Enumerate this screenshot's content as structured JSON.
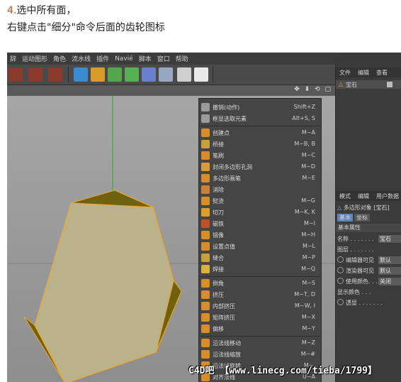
{
  "caption": {
    "step_number": "4.",
    "line1": "选中所有面，",
    "line2": "右键点击\"细分\"命令后面的齿轮图标"
  },
  "menubar": [
    "辞",
    "运动图形",
    "角色",
    "流水线",
    "插件",
    "Navié",
    "脚本",
    "窗口",
    "帮助"
  ],
  "toolbar_icons": [
    "render-region-icon",
    "render-view-icon",
    "render-settings-icon",
    "cube-icon",
    "pen-icon",
    "subdivision-icon",
    "cloner-icon",
    "deformer-icon",
    "floor-icon",
    "camera-icon",
    "light-icon"
  ],
  "viewport": {
    "nav_icons": "✥ ⬇ ⟲ ▢",
    "object_fill": "#b9b28b",
    "selected_face_color": "#6e6110",
    "edge_color": "#f2a52a"
  },
  "context_menu": {
    "items": [
      {
        "label": "撤销(动作)",
        "shortcut": "Shift+Z",
        "icon": "undo-icon"
      },
      {
        "label": "框显选取元素",
        "shortcut": "Alt+S, S",
        "icon": "frame-selection-icon"
      },
      {
        "label": "创建点",
        "shortcut": "M~A",
        "icon": "create-point-icon"
      },
      {
        "label": "桥接",
        "shortcut": "M~B, B",
        "icon": "bridge-icon"
      },
      {
        "label": "笔刷",
        "shortcut": "M~C",
        "icon": "brush-icon"
      },
      {
        "label": "封闭多边形孔洞",
        "shortcut": "M~D",
        "icon": "close-hole-icon"
      },
      {
        "label": "多边形画笔",
        "shortcut": "M~E",
        "icon": "polygon-pen-icon"
      },
      {
        "label": "消除",
        "shortcut": "",
        "icon": "dissolve-icon"
      },
      {
        "label": "熨烫",
        "shortcut": "M~G",
        "icon": "iron-icon"
      },
      {
        "label": "切刀",
        "shortcut": "M~K, K",
        "icon": "knife-icon"
      },
      {
        "label": "磁铁",
        "shortcut": "M~I",
        "icon": "magnet-icon"
      },
      {
        "label": "镜像",
        "shortcut": "M~H",
        "icon": "mirror-icon"
      },
      {
        "label": "设置点值",
        "shortcut": "M~L",
        "icon": "set-point-value-icon"
      },
      {
        "label": "缝合",
        "shortcut": "M~P",
        "icon": "stitch-icon"
      },
      {
        "label": "焊接",
        "shortcut": "M~Q",
        "icon": "weld-icon"
      },
      {
        "label": "倒角",
        "shortcut": "M~S",
        "icon": "bevel-icon"
      },
      {
        "label": "挤压",
        "shortcut": "M~T, D",
        "icon": "extrude-icon"
      },
      {
        "label": "内部挤压",
        "shortcut": "M~W, I",
        "icon": "extrude-inner-icon"
      },
      {
        "label": "矩阵挤压",
        "shortcut": "M~X",
        "icon": "matrix-extrude-icon"
      },
      {
        "label": "偏移",
        "shortcut": "M~Y",
        "icon": "offset-icon"
      },
      {
        "label": "沿法线移动",
        "shortcut": "M~Z",
        "icon": "normal-move-icon"
      },
      {
        "label": "沿法线缩放",
        "shortcut": "M~#",
        "icon": "normal-scale-icon"
      },
      {
        "label": "沿法线旋转",
        "shortcut": "M~,",
        "icon": "normal-rotate-icon"
      },
      {
        "label": "对齐法线",
        "shortcut": "U~A",
        "icon": "align-normals-icon"
      }
    ]
  },
  "object_manager": {
    "tabs": [
      "文件",
      "编辑",
      "查看"
    ],
    "object_name": "宝石"
  },
  "attribute_manager": {
    "tabs": [
      "模式",
      "编辑",
      "用户数据"
    ],
    "title": "多边形对象 [宝石]",
    "subtabs": [
      "基本",
      "坐标"
    ],
    "section": "基本属性",
    "fields": [
      {
        "label": "名称 . . . . . . .",
        "value": "宝石",
        "radio": false
      },
      {
        "label": "图层 . . . . . . .",
        "value": "",
        "radio": false
      },
      {
        "label": "编辑器可见",
        "value": "默认",
        "radio": true
      },
      {
        "label": "渲染器可见",
        "value": "默认",
        "radio": true
      },
      {
        "label": "使用颜色. . .",
        "value": "关闭",
        "radio": true
      },
      {
        "label": "显示颜色 . . .",
        "value": "",
        "radio": false
      },
      {
        "label": "透显 . . . . . . .",
        "value": "",
        "radio": true
      }
    ]
  },
  "watermark": "C4D吧 【www.linecg.com/tieba/1799】"
}
